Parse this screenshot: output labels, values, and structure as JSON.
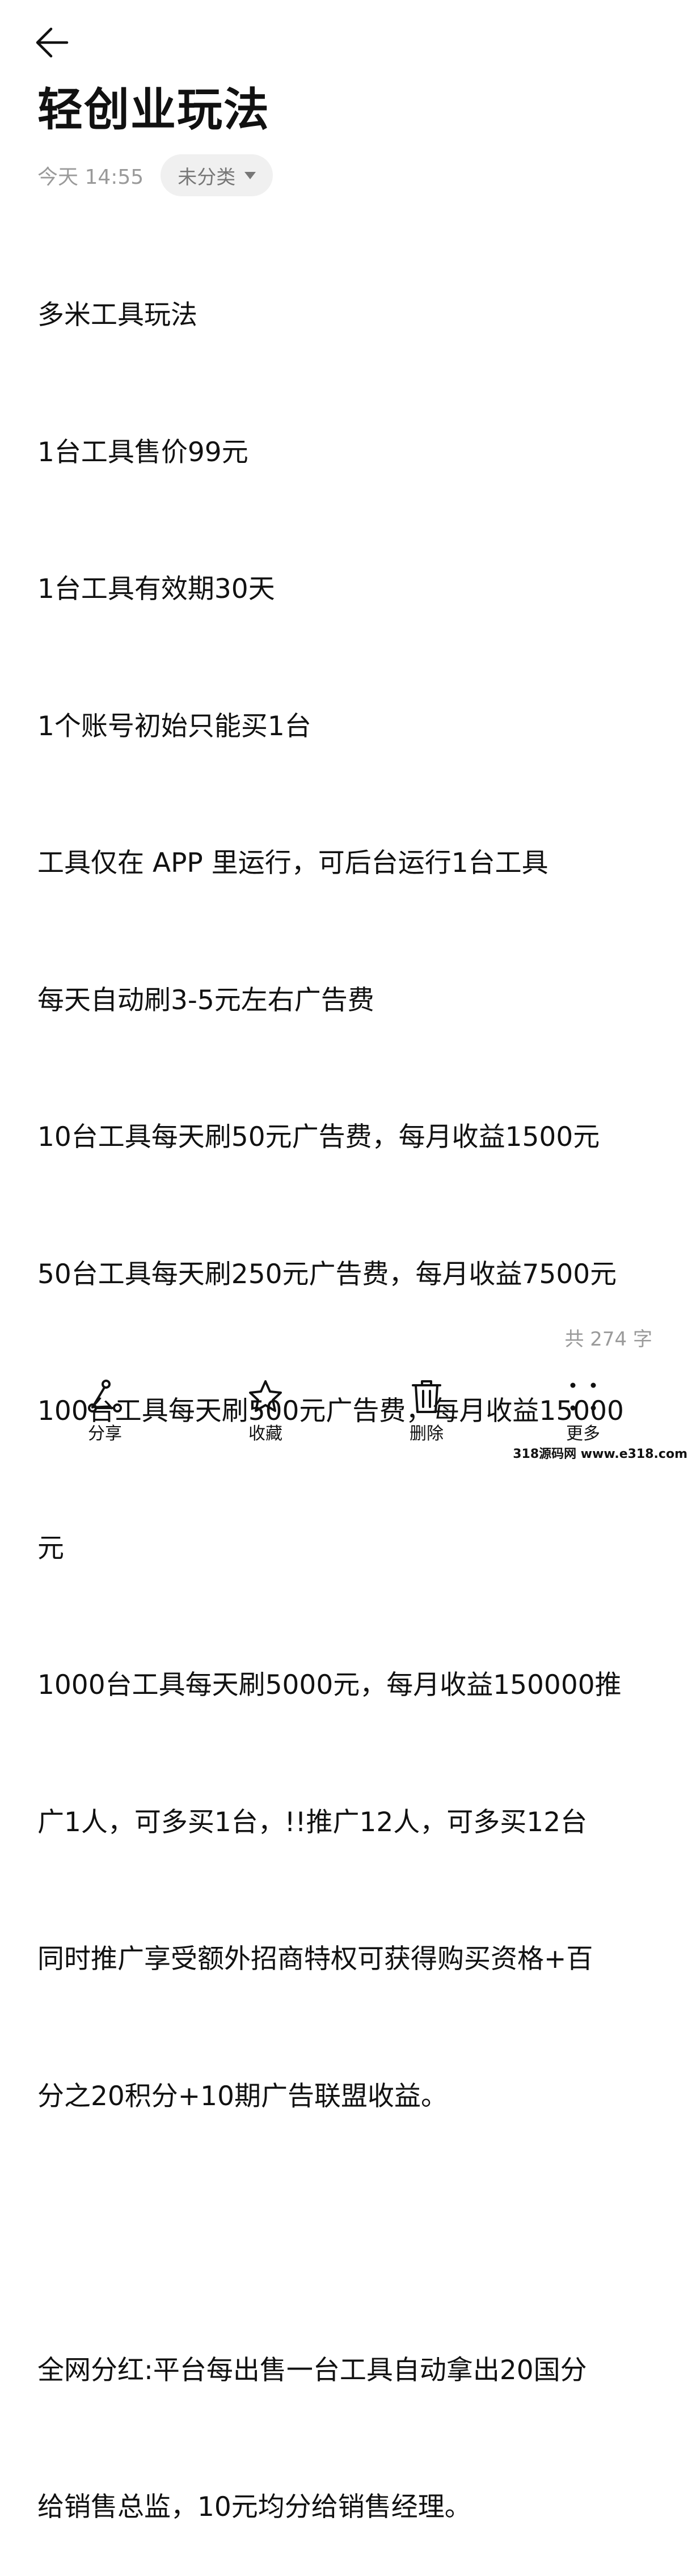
{
  "header": {
    "back_icon": "arrow-left-icon"
  },
  "note": {
    "title": "轻创业玩法",
    "date": "今天 14:55",
    "category": "未分类",
    "lines": [
      "多米工具玩法",
      "1台工具售价99元",
      "1台工具有效期30天",
      "1个账号初始只能买1台",
      "工具仅在 APP 里运行，可后台运行1台工具",
      "每天自动刷3-5元左右广告费",
      "10台工具每天刷50元广告费，每月收益1500元",
      "50台工具每天刷250元广告费，每月收益7500元",
      "100台工具每天刷500元广告费，每月收益15000",
      "元",
      "1000台工具每天刷5000元，每月收益150000推",
      "广1人，可多买1台，!!推广12人，可多买12台",
      "同时推广享受额外招商特权可获得购买资格+百",
      "分之20积分+10期广告联盟收益。",
      "",
      "全网分红:平台每出售一台工具自动拿出20国分",
      "给销售总监，10元均分给销售经理。"
    ],
    "char_count": "共 274 字"
  },
  "toolbar": {
    "share": {
      "label": "分享",
      "icon": "share-icon"
    },
    "favorite": {
      "label": "收藏",
      "icon": "star-icon"
    },
    "delete": {
      "label": "删除",
      "icon": "trash-icon"
    },
    "more": {
      "label": "更多",
      "icon": "more-dots-icon"
    }
  },
  "watermark": "318源码网 www.e318.com"
}
